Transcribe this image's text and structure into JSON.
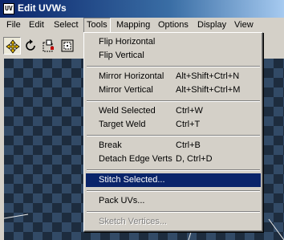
{
  "window": {
    "title": "Edit UVWs",
    "icon_name": "uvw-app-icon",
    "icon_glyph": "UV"
  },
  "menubar": {
    "items": [
      "File",
      "Edit",
      "Select",
      "Tools",
      "Mapping",
      "Options",
      "Display",
      "View"
    ],
    "open_item": "Tools"
  },
  "toolbar": {
    "tools": [
      {
        "name": "move-icon",
        "active": true
      },
      {
        "name": "rotate-icon",
        "active": false
      },
      {
        "name": "scale-icon",
        "active": false
      },
      {
        "name": "freeform-icon",
        "active": false
      }
    ]
  },
  "tools_menu": {
    "items": [
      {
        "label": "Flip Horizontal",
        "shortcut": ""
      },
      {
        "label": "Flip Vertical",
        "shortcut": ""
      },
      {
        "label": "Mirror Horizontal",
        "shortcut": "Alt+Shift+Ctrl+N"
      },
      {
        "label": "Mirror Vertical",
        "shortcut": "Alt+Shift+Ctrl+M"
      },
      {
        "label": "Weld Selected",
        "shortcut": "Ctrl+W"
      },
      {
        "label": "Target Weld",
        "shortcut": "Ctrl+T"
      },
      {
        "label": "Break",
        "shortcut": "Ctrl+B"
      },
      {
        "label": "Detach Edge Verts",
        "shortcut": "D, Ctrl+D"
      },
      {
        "label": "Stitch Selected...",
        "shortcut": "",
        "highlighted": true
      },
      {
        "label": "Pack UVs...",
        "shortcut": ""
      },
      {
        "label": "Sketch Vertices...",
        "shortcut": "",
        "disabled": true
      }
    ]
  },
  "colors": {
    "title_gradient_start": "#0a246a",
    "highlight": "#0a246a",
    "viewport_dark": "#1d2c3e",
    "viewport_light": "#324a66"
  }
}
